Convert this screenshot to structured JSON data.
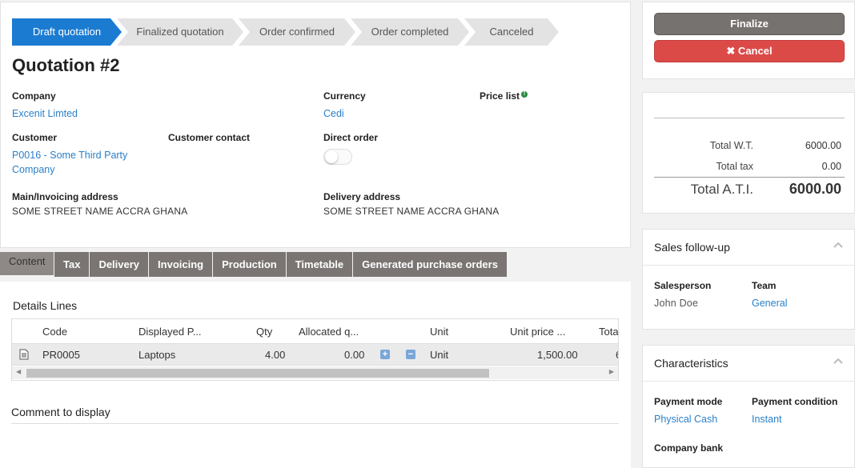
{
  "steps": [
    "Draft quotation",
    "Finalized quotation",
    "Order confirmed",
    "Order completed",
    "Canceled"
  ],
  "title": "Quotation #2",
  "fields": {
    "company_label": "Company",
    "company_value": "Excenit Limted",
    "currency_label": "Currency",
    "currency_value": "Cedi",
    "pricelist_label": "Price list",
    "customer_label": "Customer",
    "customer_value": "P0016 - Some Third Party Company",
    "customer_contact_label": "Customer contact",
    "direct_order_label": "Direct order",
    "main_address_label": "Main/Invoicing address",
    "main_address_value": "SOME STREET NAME ACCRA GHANA",
    "delivery_address_label": "Delivery address",
    "delivery_address_value": "SOME STREET NAME ACCRA GHANA"
  },
  "tabs": [
    "Content",
    "Tax",
    "Delivery",
    "Invoicing",
    "Production",
    "Timetable",
    "Generated purchase orders"
  ],
  "details": {
    "title": "Details Lines",
    "columns": [
      "Code",
      "Displayed P...",
      "Qty",
      "Allocated q...",
      "Unit",
      "Unit price ...",
      "Tota"
    ],
    "rows": [
      {
        "code": "PR0005",
        "name": "Laptops",
        "qty": "4.00",
        "allocated": "0.00",
        "unit": "Unit",
        "unit_price": "1,500.00",
        "total": "6"
      }
    ]
  },
  "comment_label": "Comment to display",
  "actions": {
    "finalize": "Finalize",
    "cancel": "✖ Cancel"
  },
  "totals": {
    "wt_label": "Total W.T.",
    "wt_value": "6000.00",
    "tax_label": "Total tax",
    "tax_value": "0.00",
    "ati_label": "Total A.T.I.",
    "ati_value": "6000.00"
  },
  "sales_followup": {
    "title": "Sales follow-up",
    "salesperson_label": "Salesperson",
    "salesperson_value": "John Doe",
    "team_label": "Team",
    "team_value": "General"
  },
  "characteristics": {
    "title": "Characteristics",
    "payment_mode_label": "Payment mode",
    "payment_mode_value": "Physical Cash",
    "payment_condition_label": "Payment condition",
    "payment_condition_value": "Instant",
    "company_bank_label": "Company bank"
  },
  "colors": {
    "accent": "#1b7bd1",
    "link": "#2a80c8",
    "danger": "#dc4a48",
    "tab": "#7a7573"
  }
}
